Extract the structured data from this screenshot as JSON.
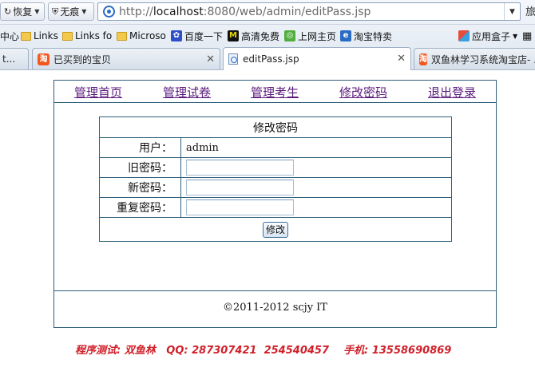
{
  "browser": {
    "toolbar": {
      "restore_label": "恢复",
      "no_trace_label": "无痕",
      "url_prefix": "http://",
      "url_host": "localhost",
      "url_rest": ":8080/web/admin/editPass.jsp",
      "right_cut_label": "旅"
    },
    "bookmarks": [
      {
        "label": "中心",
        "icon": "text"
      },
      {
        "label": "Links",
        "icon": "folder-icon"
      },
      {
        "label": "Links fo",
        "icon": "folder-icon"
      },
      {
        "label": "Microso",
        "icon": "folder-icon"
      },
      {
        "label": "百度一下",
        "icon": "baidu-paw-icon"
      },
      {
        "label": "高清免费",
        "icon": "m-logo-icon"
      },
      {
        "label": "上网主页",
        "icon": "globe-icon"
      },
      {
        "label": "淘宝特卖",
        "icon": "ie-page-icon"
      },
      {
        "label": "应用盒子",
        "icon": "app-box-icon"
      }
    ],
    "tabs": [
      {
        "label": "t...",
        "active": false
      },
      {
        "label": "已买到的宝贝",
        "active": false
      },
      {
        "label": "editPass.jsp",
        "active": true
      },
      {
        "label": "双鱼林学习系统淘宝店- ...",
        "active": false
      }
    ],
    "colors": {
      "accent": "#2a6cc4",
      "taobao": "#f3571d"
    }
  },
  "nav": {
    "items": [
      "管理首页",
      "管理试卷",
      "管理考生",
      "修改密码",
      "退出登录"
    ],
    "link_color": "#5a1a7c"
  },
  "form": {
    "title": "修改密码",
    "user_label": "用户：",
    "user_value": "admin",
    "old_password_label": "旧密码：",
    "new_password_label": "新密码：",
    "repeat_password_label": "重复密码：",
    "submit_label": "修改",
    "border_color": "#2e5f7a"
  },
  "footer": {
    "copyright": "©2011-2012 scjy IT"
  },
  "tester_note": {
    "text": "程序测试: 双鱼林   QQ: 287307421  254540457    手机: 13558690869",
    "color": "#d0202a"
  }
}
